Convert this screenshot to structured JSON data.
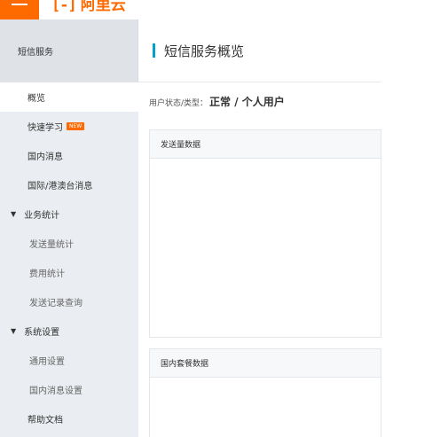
{
  "header": {
    "logo_mark": "[-]",
    "logo_text": "阿里云"
  },
  "sidebar": {
    "title": "短信服务",
    "items": [
      {
        "label": "概览",
        "active": true
      },
      {
        "label": "快速学习",
        "badge": "NEW"
      },
      {
        "label": "国内消息"
      },
      {
        "label": "国际/港澳台消息"
      },
      {
        "label": "业务统计",
        "group": true,
        "expanded": true
      },
      {
        "label": "发送量统计",
        "sub": true
      },
      {
        "label": "费用统计",
        "sub": true
      },
      {
        "label": "发送记录查询",
        "sub": true
      },
      {
        "label": "系统设置",
        "group": true,
        "expanded": true
      },
      {
        "label": "通用设置",
        "sub": true
      },
      {
        "label": "国内消息设置",
        "sub": true
      },
      {
        "label": "帮助文档"
      }
    ]
  },
  "main": {
    "title": "短信服务概览",
    "status_label": "用户状态/类型：",
    "status_value": "正常 / 个人用户",
    "panels": [
      {
        "title": "发送量数据"
      },
      {
        "title": "国内套餐数据"
      }
    ]
  },
  "colors": {
    "brand": "#ff6a00",
    "accent": "#00a2ca",
    "sidebar_bg": "#eaedf1"
  }
}
